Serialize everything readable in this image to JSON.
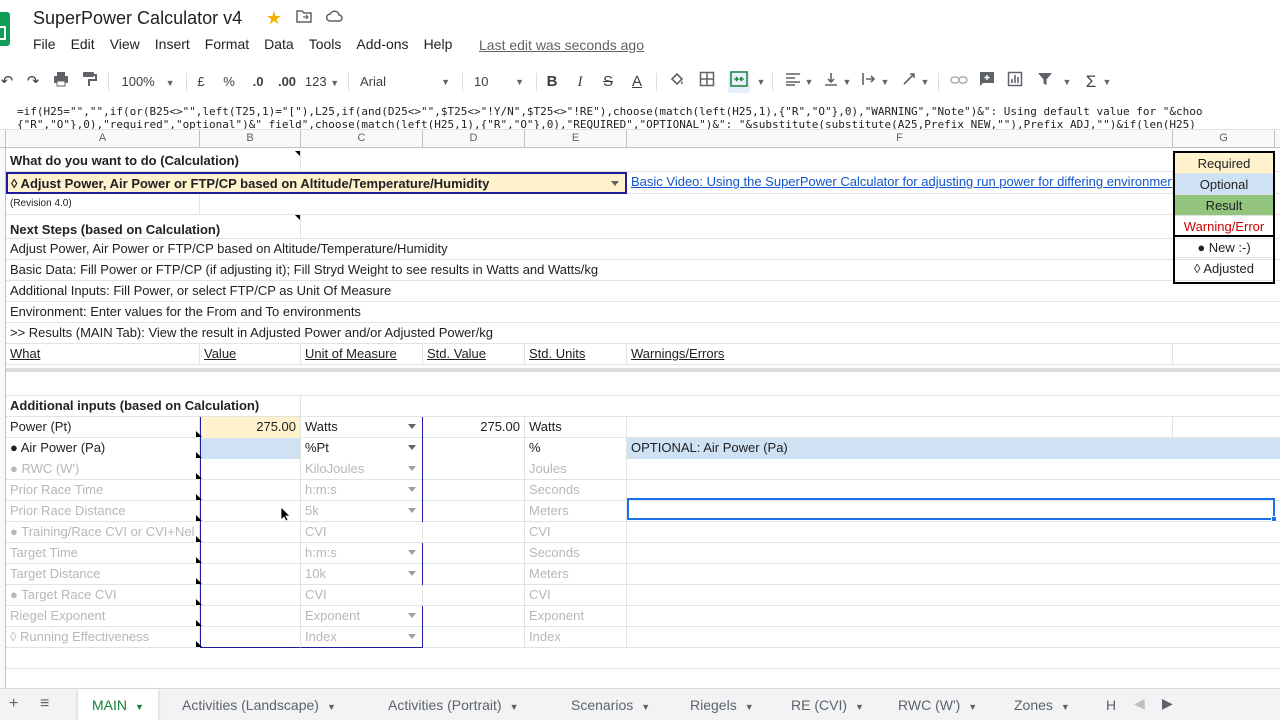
{
  "doc": {
    "title": "SuperPower Calculator v4",
    "last_edit": "Last edit was seconds ago"
  },
  "menu": [
    "File",
    "Edit",
    "View",
    "Insert",
    "Format",
    "Data",
    "Tools",
    "Add-ons",
    "Help"
  ],
  "toolbar": {
    "zoom": "100%",
    "currency": "£",
    "percent": "%",
    "dec_less": ".0",
    "dec_more": ".00",
    "number_format": "123",
    "font": "Arial",
    "font_size": "10"
  },
  "formula": {
    "line1": "=if(H25=\"\",\"\",if(or(B25<>\"\",left(T25,1)=\"[\"),L25,if(and(D25<>\"\",$T25<>\"!Y/N\",$T25<>\"!RE\"),choose(match(left(H25,1),{\"R\",\"O\"},0),\"WARNING\",\"Note\")&\": Using default value for \"&choo",
    "line2": "{\"R\",\"O\"},0),\"required\",\"optional\")&\" field\",choose(match(left(H25,1),{\"R\",\"O\"},0),\"REQUIRED\",\"OPTIONAL\")&\": \"&substitute(substitute(A25,Prefix_NEW,\"\"),Prefix_ADJ,\"\")&if(len(H25)"
  },
  "columns": [
    "A",
    "B",
    "C",
    "D",
    "E",
    "F",
    "G"
  ],
  "sheet": {
    "calc_header": "What do you want to do (Calculation)",
    "calc_value": "◊ Adjust Power, Air Power or FTP/CP based on Altitude/Temperature/Humidity",
    "video_link": "Basic Video: Using the SuperPower Calculator for adjusting run power for differing environments",
    "revision": "(Revision 4.0)",
    "next_steps": "Next Steps (based on Calculation)",
    "step1": "Adjust Power, Air Power or FTP/CP based on Altitude/Temperature/Humidity",
    "step2": "Basic Data: Fill Power or FTP/CP (if adjusting it); Fill Stryd Weight to see results in Watts and Watts/kg",
    "step3": "Additional Inputs: Fill Power, or select FTP/CP as Unit Of Measure",
    "step4": "Environment: Enter values for the From and To environments",
    "step5": ">> Results (MAIN Tab): View the result in Adjusted Power and/or Adjusted Power/kg",
    "headers": {
      "what": "What",
      "value": "Value",
      "uom": "Unit of Measure",
      "std_value": "Std. Value",
      "std_units": "Std. Units",
      "warnings": "Warnings/Errors"
    },
    "additional_inputs": "Additional inputs (based on Calculation)",
    "inputs": [
      {
        "what": "Power (Pt)",
        "value": "275.00",
        "uom": "Watts",
        "std_value": "275.00",
        "std_units": "Watts",
        "warning": ""
      },
      {
        "what": "● Air Power (Pa)",
        "value": "",
        "uom": "%Pt",
        "std_value": "",
        "std_units": "%",
        "warning": "OPTIONAL: Air Power (Pa)"
      },
      {
        "what": "● RWC (W')",
        "value": "",
        "uom": "KiloJoules",
        "std_value": "",
        "std_units": "Joules",
        "warning": ""
      },
      {
        "what": "Prior Race Time",
        "value": "",
        "uom": "h:m:s",
        "std_value": "",
        "std_units": "Seconds",
        "warning": ""
      },
      {
        "what": "Prior Race Distance",
        "value": "",
        "uom": "5k",
        "std_value": "",
        "std_units": "Meters",
        "warning": ""
      },
      {
        "what": "● Training/Race CVI or CVI+Nel",
        "value": "",
        "uom": "CVI",
        "std_value": "",
        "std_units": "CVI",
        "warning": ""
      },
      {
        "what": "Target Time",
        "value": "",
        "uom": "h:m:s",
        "std_value": "",
        "std_units": "Seconds",
        "warning": ""
      },
      {
        "what": "Target Distance",
        "value": "",
        "uom": "10k",
        "std_value": "",
        "std_units": "Meters",
        "warning": ""
      },
      {
        "what": "● Target Race CVI",
        "value": "",
        "uom": "CVI",
        "std_value": "",
        "std_units": "CVI",
        "warning": ""
      },
      {
        "what": "Riegel Exponent",
        "value": "",
        "uom": "Exponent",
        "std_value": "",
        "std_units": "Exponent",
        "warning": ""
      },
      {
        "what": "◊ Running Effectiveness",
        "value": "",
        "uom": "Index",
        "std_value": "",
        "std_units": "Index",
        "warning": ""
      }
    ]
  },
  "legend": [
    "Required",
    "Optional",
    "Result",
    "Warning/Error",
    "● New :-)",
    "◊ Adjusted"
  ],
  "colors": {
    "required": "#fff2cc",
    "optional": "#cfe2f3",
    "result": "#93c47d",
    "warning": "#cc0000",
    "calc_fill": "#fff2cc",
    "calc_border": "#1c1c9c"
  },
  "tabs": [
    "MAIN",
    "Activities (Landscape)",
    "Activities (Portrait)",
    "Scenarios",
    "Riegels",
    "RE (CVI)",
    "RWC (W')",
    "Zones",
    "H"
  ]
}
